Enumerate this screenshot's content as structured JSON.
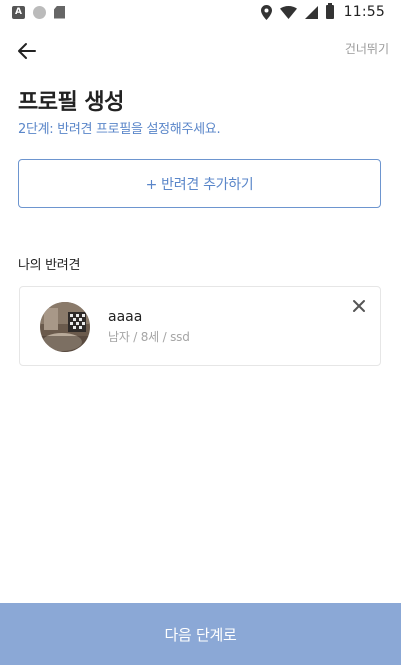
{
  "status_bar": {
    "time": "11:55",
    "left_icons": [
      "a-notification-icon",
      "circle-notification-icon",
      "sd-card-icon"
    ],
    "right_icons": [
      "location-icon",
      "wifi-icon",
      "signal-icon",
      "battery-icon"
    ]
  },
  "header": {
    "back_icon": "arrow-left-icon",
    "skip_label": "건너뛰기"
  },
  "title": "프로필 생성",
  "subtitle": "2단계: 반려견 프로필을 설정해주세요.",
  "add_button_label": "+ 반려견 추가하기",
  "section_title": "나의 반려견",
  "pets": [
    {
      "name": "aaaa",
      "info": "남자 / 8세 / ssd",
      "remove_icon": "close-icon"
    }
  ],
  "next_button_label": "다음 단계로",
  "colors": {
    "accent": "#5a86c9",
    "border_accent": "#6d95cf",
    "next_button_bg": "#8ba8d6"
  }
}
